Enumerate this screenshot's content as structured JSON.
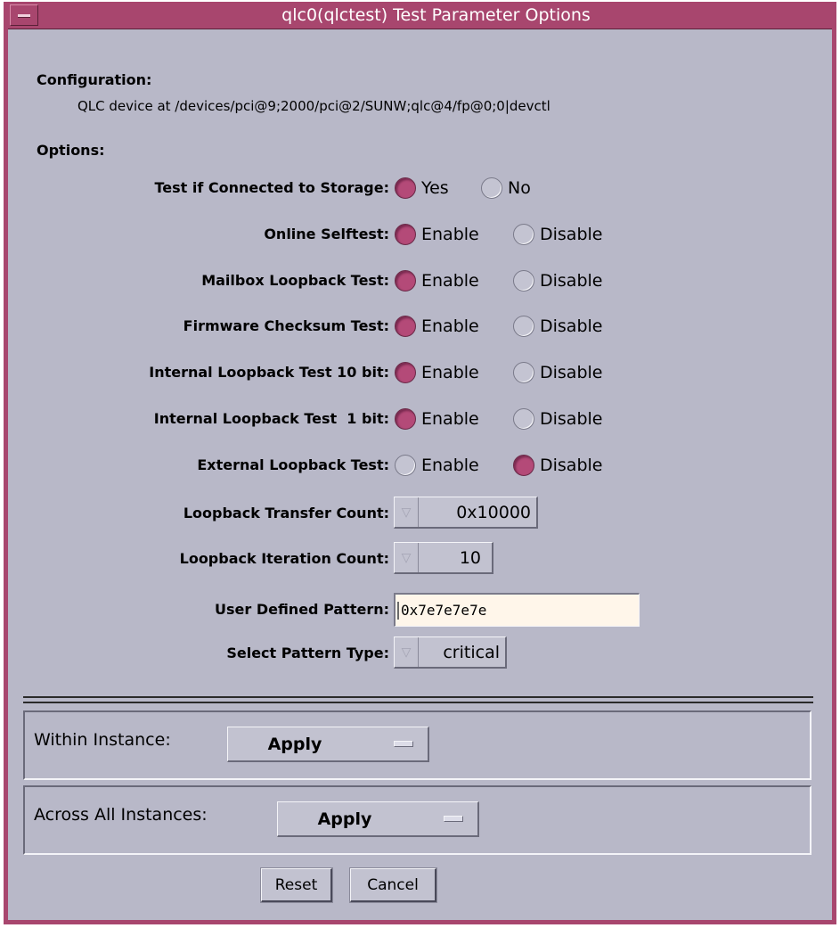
{
  "window": {
    "title": "qlc0(qlctest) Test Parameter Options"
  },
  "configuration": {
    "label": "Configuration:",
    "path": "QLC device at /devices/pci@9;2000/pci@2/SUNW;qlc@4/fp@0;0|devctl"
  },
  "options": {
    "label": "Options:",
    "radios": [
      {
        "label": "Test if Connected to Storage:",
        "opt1": "Yes",
        "opt2": "No",
        "selected": "Yes"
      },
      {
        "label": "Online Selftest:",
        "opt1": "Enable",
        "opt2": "Disable",
        "selected": "Enable"
      },
      {
        "label": "Mailbox Loopback Test:",
        "opt1": "Enable",
        "opt2": "Disable",
        "selected": "Enable"
      },
      {
        "label": "Firmware Checksum Test:",
        "opt1": "Enable",
        "opt2": "Disable",
        "selected": "Enable"
      },
      {
        "label": "Internal Loopback Test 10 bit:",
        "opt1": "Enable",
        "opt2": "Disable",
        "selected": "Enable"
      },
      {
        "label": "Internal Loopback Test  1 bit:",
        "opt1": "Enable",
        "opt2": "Disable",
        "selected": "Enable"
      },
      {
        "label": "External Loopback Test:",
        "opt1": "Enable",
        "opt2": "Disable",
        "selected": "Disable"
      }
    ],
    "transfer_count": {
      "label": "Loopback Transfer Count:",
      "value": "0x10000"
    },
    "iteration_count": {
      "label": "Loopback Iteration Count:",
      "value": "10"
    },
    "user_pattern": {
      "label": "User Defined Pattern:",
      "value": "0x7e7e7e7e"
    },
    "pattern_type": {
      "label": "Select Pattern Type:",
      "value": "critical"
    }
  },
  "scope": {
    "within": {
      "label": "Within Instance:",
      "value": "Apply"
    },
    "across": {
      "label": "Across All Instances:",
      "value": "Apply"
    }
  },
  "buttons": {
    "reset": "Reset",
    "cancel": "Cancel"
  },
  "colors": {
    "accent": "#a8466e",
    "background": "#b8b8c8",
    "field": "#fff6ea"
  }
}
